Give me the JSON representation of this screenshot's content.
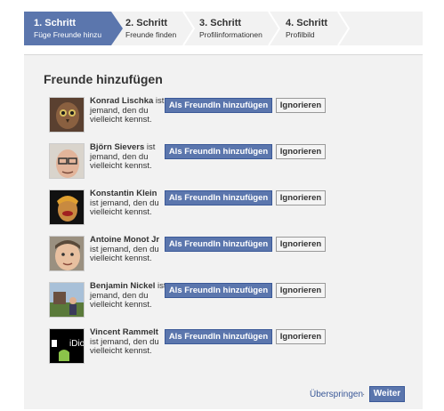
{
  "steps": [
    {
      "title": "1. Schritt",
      "subtitle": "Füge Freunde hinzu"
    },
    {
      "title": "2. Schritt",
      "subtitle": "Freunde finden"
    },
    {
      "title": "3. Schritt",
      "subtitle": "Profilinformationen"
    },
    {
      "title": "4. Schritt",
      "subtitle": "Profilbild"
    }
  ],
  "heading": "Freunde hinzufügen",
  "friends": [
    {
      "name": "Konrad Lischka",
      "line1": " ist",
      "line2": "jemand, den du",
      "line3": "vielleicht kennst."
    },
    {
      "name": "Björn Sievers",
      "line1": " ist",
      "line2": "jemand, den du",
      "line3": "vielleicht kennst."
    },
    {
      "name": "Konstantin Klein",
      "line1": "",
      "line2": "ist jemand, den du",
      "line3": "vielleicht kennst."
    },
    {
      "name": "Antoine Monot Jr",
      "line1": "",
      "line2": "ist jemand, den du",
      "line3": "vielleicht kennst."
    },
    {
      "name": "Benjamin Nickel",
      "line1": " ist",
      "line2": "jemand, den du",
      "line3": "vielleicht kennst."
    },
    {
      "name": "Vincent Rammelt",
      "line1": "",
      "line2": "ist jemand, den du",
      "line3": "vielleicht kennst."
    }
  ],
  "buttons": {
    "add_label": "Als FreundIn hinzufügen",
    "ignore_label": "Ignorieren",
    "skip_label": "Überspringen",
    "separator": "·",
    "next_label": "Weiter"
  },
  "avatar_texts": {
    "vincent_logo": "iDiot"
  },
  "colors": {
    "accent": "#5b76ad",
    "accent_border": "#3b5998",
    "panel_bg": "#f2f2f2"
  }
}
